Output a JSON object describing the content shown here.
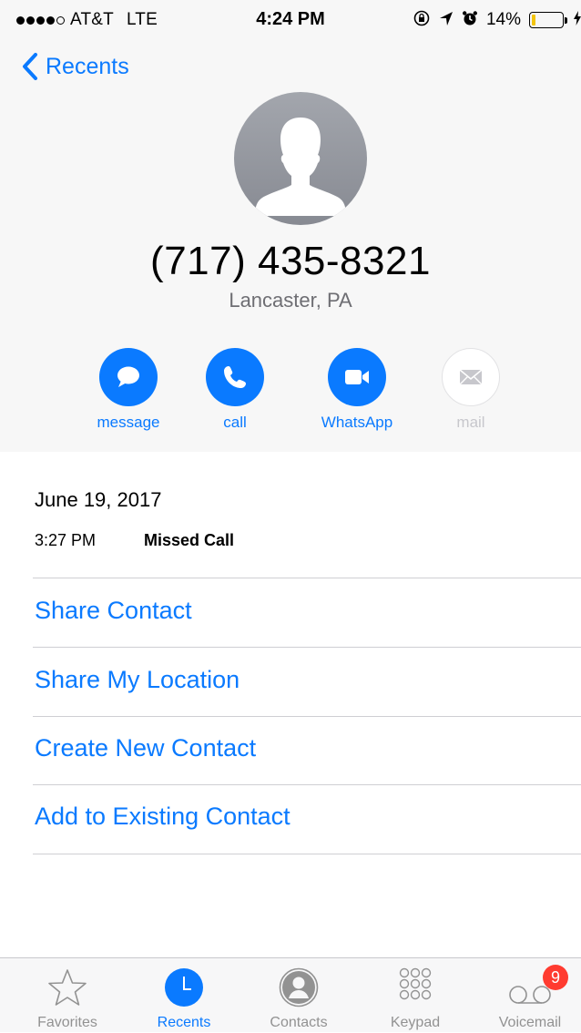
{
  "status_bar": {
    "carrier": "AT&T",
    "network": "LTE",
    "time": "4:24 PM",
    "battery": "14%",
    "battery_level": 0.14
  },
  "nav": {
    "back_label": "Recents"
  },
  "contact": {
    "phone_number": "(717) 435-8321",
    "location": "Lancaster, PA"
  },
  "actions": [
    {
      "label": "message",
      "icon": "message-bubble-icon",
      "enabled": true
    },
    {
      "label": "call",
      "icon": "phone-icon",
      "enabled": true
    },
    {
      "label": "WhatsApp",
      "icon": "video-camera-icon",
      "enabled": true
    },
    {
      "label": "mail",
      "icon": "envelope-icon",
      "enabled": false
    }
  ],
  "call_log": {
    "date": "June 19, 2017",
    "entries": [
      {
        "time": "3:27 PM",
        "type": "Missed Call"
      }
    ]
  },
  "menu": [
    "Share Contact",
    "Share My Location",
    "Create New Contact",
    "Add to Existing Contact"
  ],
  "tabbar": {
    "tabs": [
      {
        "label": "Favorites",
        "icon": "star-icon",
        "active": false
      },
      {
        "label": "Recents",
        "icon": "clock-icon",
        "active": true
      },
      {
        "label": "Contacts",
        "icon": "person-circle-icon",
        "active": false
      },
      {
        "label": "Keypad",
        "icon": "keypad-icon",
        "active": false
      },
      {
        "label": "Voicemail",
        "icon": "voicemail-icon",
        "active": false,
        "badge": "9"
      }
    ]
  },
  "colors": {
    "accent": "#0a7aff",
    "header_bg": "#f7f7f7",
    "badge": "#ff3b30",
    "battery_low": "#f2c40f"
  }
}
